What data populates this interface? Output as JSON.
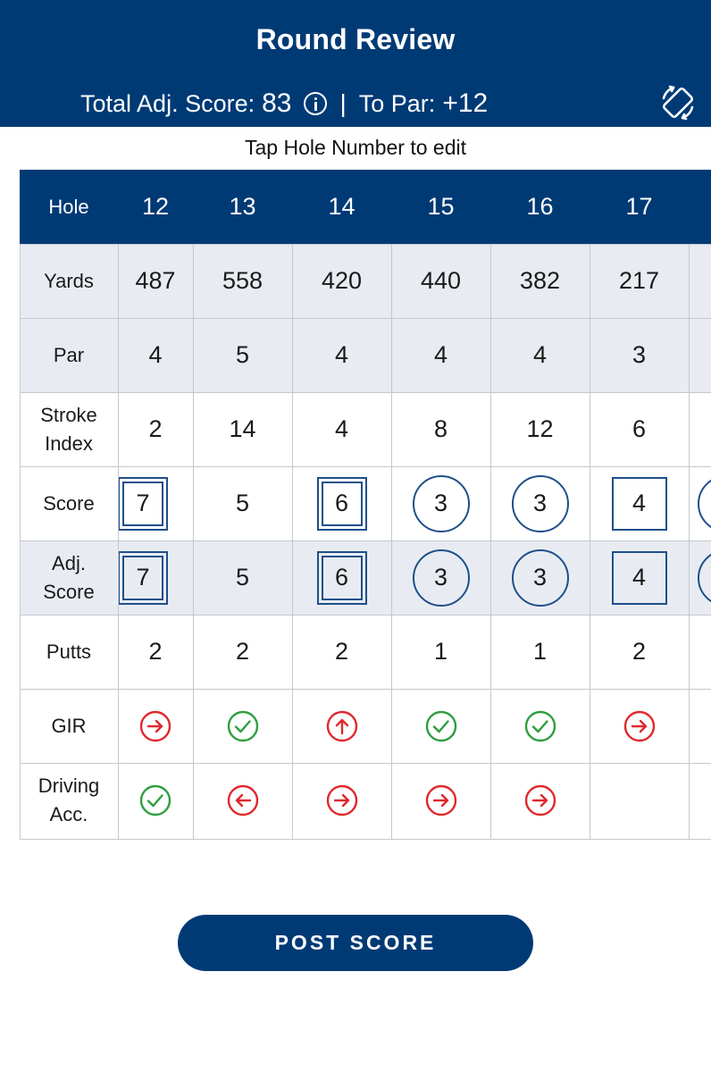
{
  "header": {
    "title": "Round Review",
    "total_label": "Total Adj. Score:",
    "total_value": "83",
    "separator": "|",
    "to_par_label": "To Par:",
    "to_par_value": "+12"
  },
  "hint": "Tap Hole Number to edit",
  "scorecard": {
    "labels": {
      "hole": "Hole",
      "yards": "Yards",
      "par": "Par",
      "stroke_index_1": "Stroke",
      "stroke_index_2": "Index",
      "score": "Score",
      "adj_score_1": "Adj.",
      "adj_score_2": "Score",
      "putts": "Putts",
      "gir": "GIR",
      "driving_1": "Driving",
      "driving_2": "Acc."
    },
    "holes": [
      {
        "hole": "12",
        "yards": "487",
        "par": "4",
        "stroke_index": "2",
        "score": "7",
        "score_style": "double-square",
        "adj_score": "7",
        "putts": "2",
        "gir": "right",
        "driving": "check"
      },
      {
        "hole": "13",
        "yards": "558",
        "par": "5",
        "stroke_index": "14",
        "score": "5",
        "score_style": "plain",
        "adj_score": "5",
        "putts": "2",
        "gir": "check",
        "driving": "left"
      },
      {
        "hole": "14",
        "yards": "420",
        "par": "4",
        "stroke_index": "4",
        "score": "6",
        "score_style": "double-square",
        "adj_score": "6",
        "putts": "2",
        "gir": "up",
        "driving": "right"
      },
      {
        "hole": "15",
        "yards": "440",
        "par": "4",
        "stroke_index": "8",
        "score": "3",
        "score_style": "circle",
        "adj_score": "3",
        "putts": "1",
        "gir": "check",
        "driving": "right"
      },
      {
        "hole": "16",
        "yards": "382",
        "par": "4",
        "stroke_index": "12",
        "score": "3",
        "score_style": "circle",
        "adj_score": "3",
        "putts": "1",
        "gir": "check",
        "driving": "right"
      },
      {
        "hole": "17",
        "yards": "217",
        "par": "3",
        "stroke_index": "6",
        "score": "4",
        "score_style": "square",
        "adj_score": "4",
        "putts": "2",
        "gir": "right",
        "driving": ""
      }
    ]
  },
  "post_button": "POST SCORE",
  "colors": {
    "brand": "#003a75",
    "hit": "#2e9e3e",
    "miss": "#e0282c",
    "score_mark": "#1f4f8a"
  },
  "icons": {
    "info": "info-icon",
    "rotate": "rotate-screen-icon",
    "hit": "check-circle-icon",
    "miss_right": "arrow-right-circle-icon",
    "miss_left": "arrow-left-circle-icon",
    "miss_long": "arrow-up-circle-icon"
  }
}
